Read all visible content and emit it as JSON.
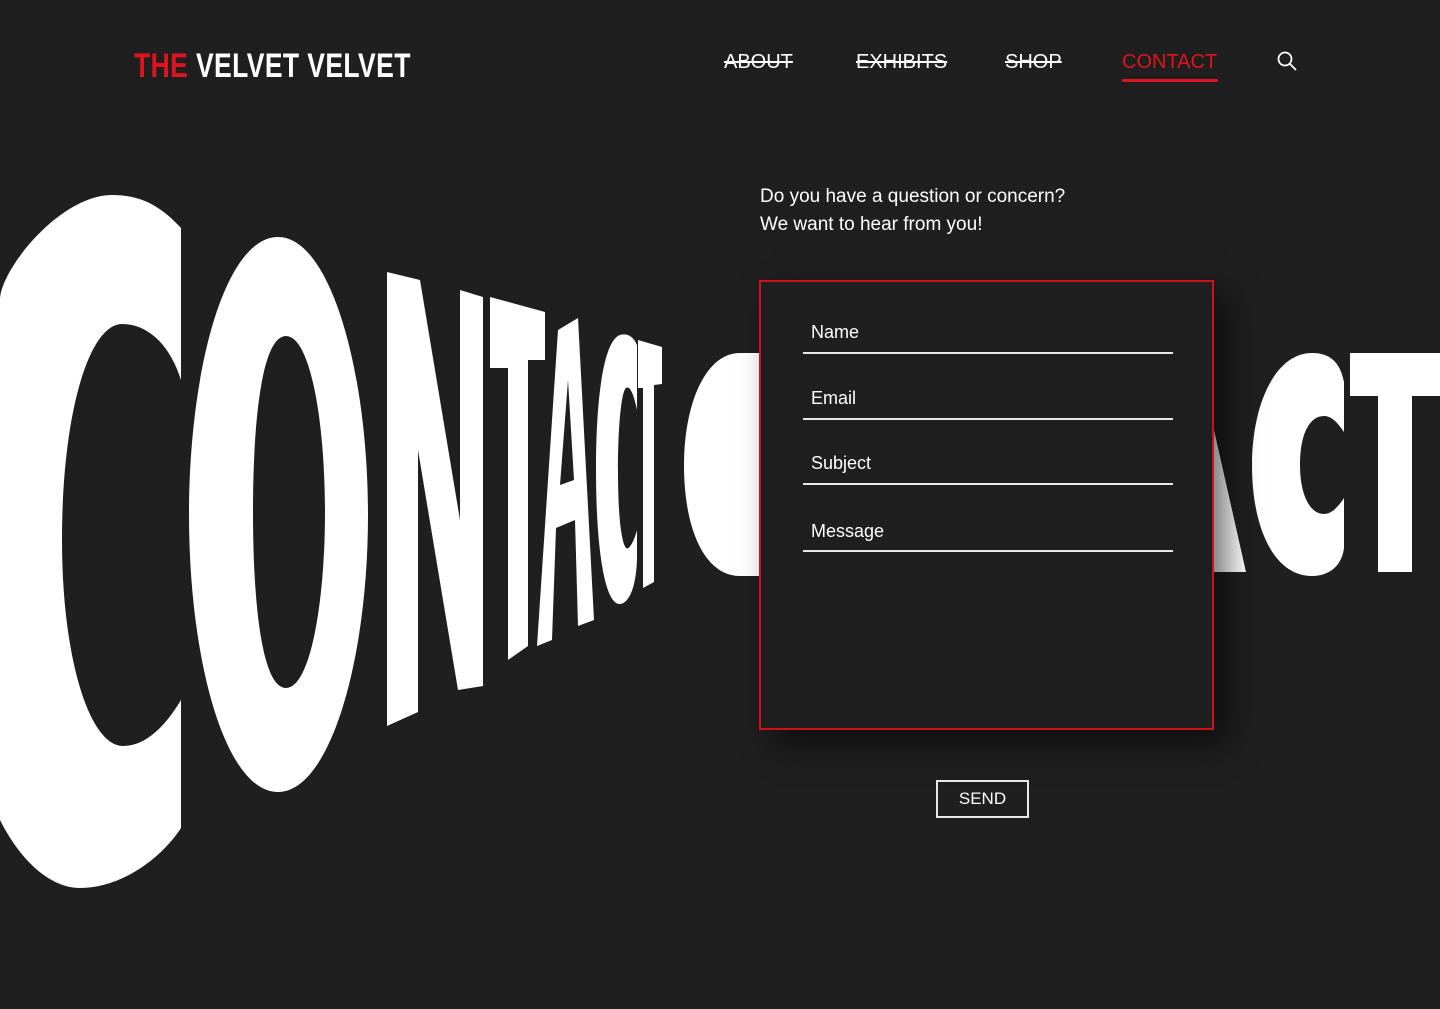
{
  "header": {
    "logo": {
      "prefix": "THE",
      "name": "VELVET VELVET"
    },
    "nav": [
      {
        "label": "ABOUT"
      },
      {
        "label": "EXHIBITS"
      },
      {
        "label": "SHOP"
      },
      {
        "label": "CONTACT"
      }
    ],
    "search_icon": "search-icon"
  },
  "hero": {
    "word_left": "CONTACT",
    "word_right": "CONTACT"
  },
  "intro": {
    "line1": "Do you have a question or concern?",
    "line2": "We want to hear from you!"
  },
  "form": {
    "name_placeholder": "Name",
    "email_placeholder": "Email",
    "subject_placeholder": "Subject",
    "message_placeholder": "Message",
    "send_label": "SEND"
  },
  "colors": {
    "background": "#201f20",
    "accent": "#e0141e",
    "text": "#ffffff"
  }
}
